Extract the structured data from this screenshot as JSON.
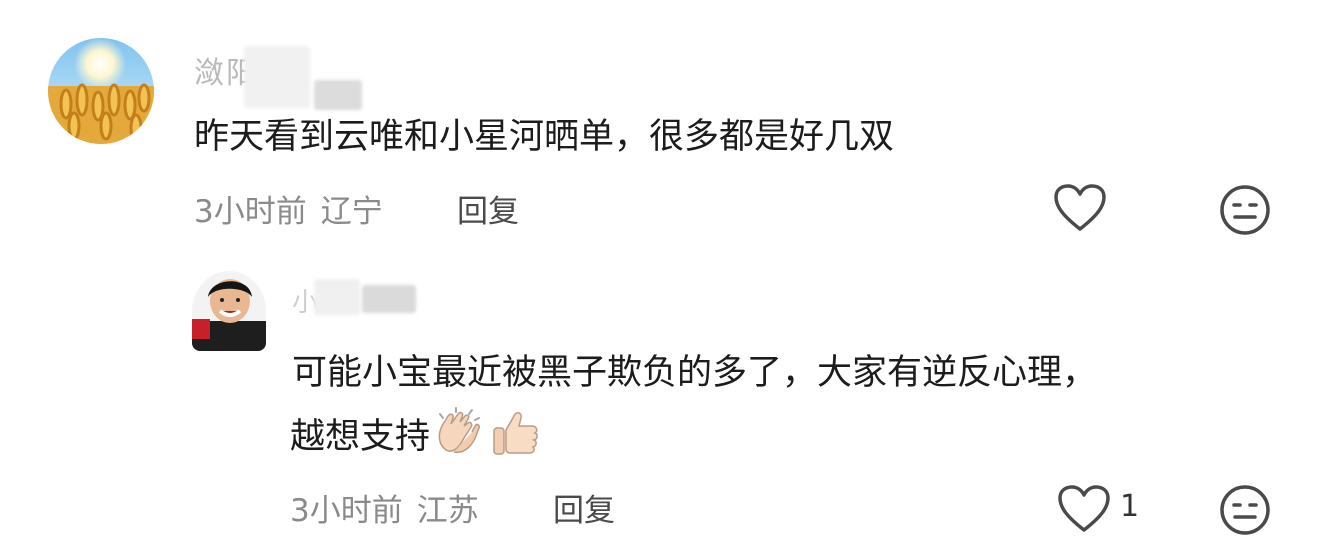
{
  "comments": [
    {
      "username": "潋阳昭",
      "text": "昨天看到云唯和小星河晒单，很多都是好几双",
      "time": "3小时前",
      "location": "辽宁",
      "reply_label": "回复"
    },
    {
      "username": "小红",
      "text_line1": "可能小宝最近被黑子欺负的多了，大家有逆反心理，",
      "text_line2": "越想支持",
      "emojis": [
        "clapping-hands",
        "thumbs-up"
      ],
      "time": "3小时前",
      "location": "江苏",
      "reply_label": "回复",
      "like_count": "1"
    }
  ],
  "colors": {
    "icon_stroke": "#4a4a4a",
    "meta_text": "#8a8a8a",
    "username": "#b9b9b9"
  }
}
